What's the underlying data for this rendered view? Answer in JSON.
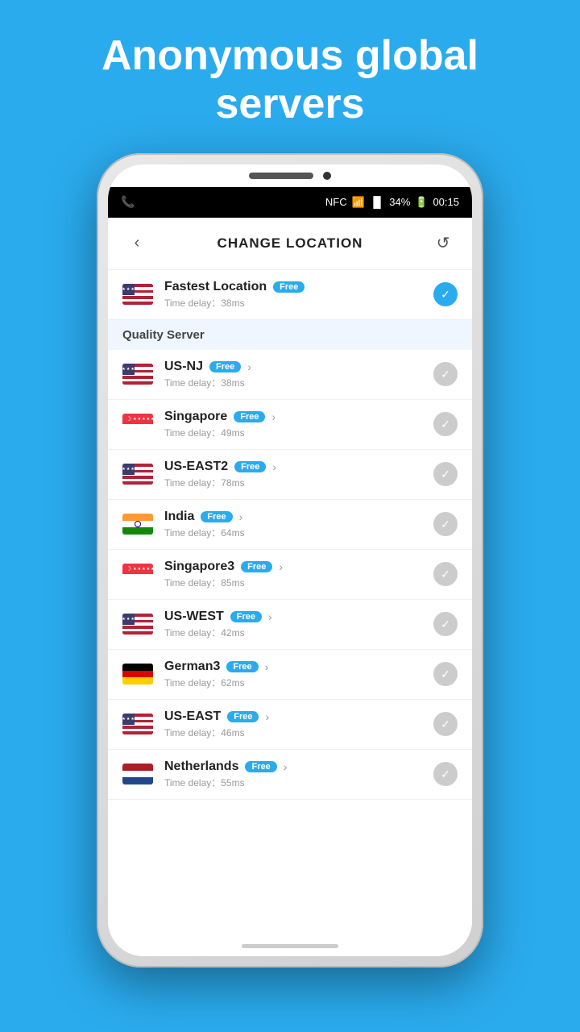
{
  "hero": {
    "title": "Anonymous global servers"
  },
  "status_bar": {
    "time": "00:15",
    "battery": "34%",
    "signal_icon": "📶",
    "wifi_icon": "NFC",
    "phone_icon": "📞"
  },
  "header": {
    "title": "CHANGE LOCATION",
    "back_label": "‹",
    "refresh_label": "↺"
  },
  "fastest_location": {
    "name": "Fastest Location",
    "badge": "Free",
    "delay": "Time delay：38ms"
  },
  "section_header": "Quality Server",
  "servers": [
    {
      "name": "US-NJ",
      "badge": "Free",
      "delay": "Time delay：38ms",
      "flag": "us",
      "has_chevron": true
    },
    {
      "name": "Singapore",
      "badge": "Free",
      "delay": "Time delay：49ms",
      "flag": "sg",
      "has_chevron": true
    },
    {
      "name": "US-EAST2",
      "badge": "Free",
      "delay": "Time delay：78ms",
      "flag": "us",
      "has_chevron": true
    },
    {
      "name": "India",
      "badge": "Free",
      "delay": "Time delay：64ms",
      "flag": "in",
      "has_chevron": true
    },
    {
      "name": "Singapore3",
      "badge": "Free",
      "delay": "Time delay：85ms",
      "flag": "sg",
      "has_chevron": true
    },
    {
      "name": "US-WEST",
      "badge": "Free",
      "delay": "Time delay：42ms",
      "flag": "us",
      "has_chevron": true
    },
    {
      "name": "German3",
      "badge": "Free",
      "delay": "Time delay：62ms",
      "flag": "de",
      "has_chevron": true
    },
    {
      "name": "US-EAST",
      "badge": "Free",
      "delay": "Time delay：46ms",
      "flag": "us",
      "has_chevron": true
    },
    {
      "name": "Netherlands",
      "badge": "Free",
      "delay": "Time delay：55ms",
      "flag": "nl",
      "has_chevron": true
    }
  ]
}
